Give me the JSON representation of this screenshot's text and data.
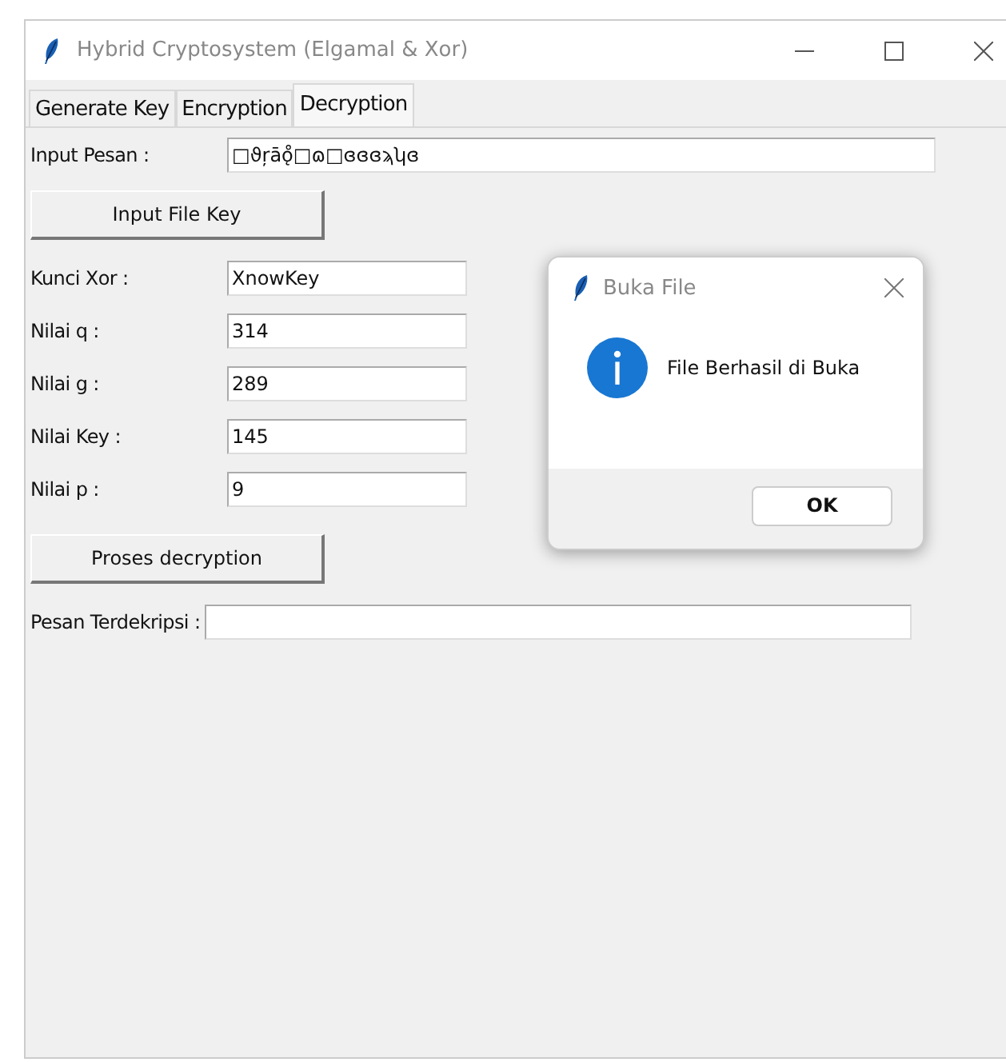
{
  "window": {
    "title": "Hybrid Cryptosystem (Elgamal & Xor)"
  },
  "tabs": [
    {
      "label": "Generate Key",
      "selected": false
    },
    {
      "label": "Encryption",
      "selected": false
    },
    {
      "label": "Decryption",
      "selected": true
    }
  ],
  "input_message": {
    "label": "Input Pesan :",
    "value": "□ϑŗāǫ̊□ɷ□ɞɞɞϡʮɞ"
  },
  "file_key_button": "Input File Key",
  "fields": [
    {
      "label": "Kunci Xor :",
      "value": "XnowKey"
    },
    {
      "label": "Nilai q :",
      "value": "314"
    },
    {
      "label": "Nilai g :",
      "value": "289"
    },
    {
      "label": "Nilai Key :",
      "value": "145"
    },
    {
      "label": "Nilai p :",
      "value": "9"
    }
  ],
  "process_button": "Proses decryption",
  "output_message": {
    "label": "Pesan Terdekripsi :"
  },
  "dialog": {
    "title": "Buka File",
    "message": "File Berhasil di Buka",
    "button": "OK"
  }
}
